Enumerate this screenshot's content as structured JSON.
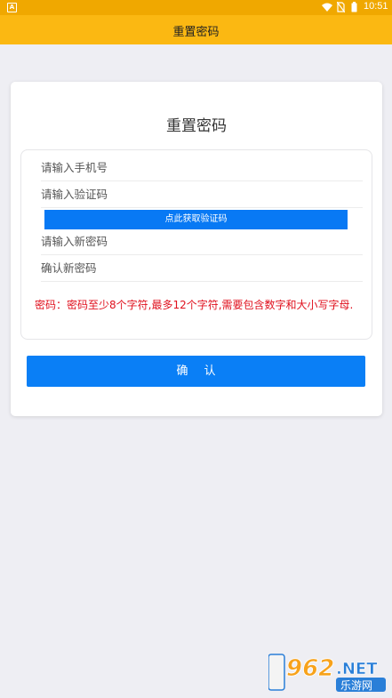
{
  "status_bar": {
    "app_icon_letter": "A",
    "time": "10:51"
  },
  "app_bar": {
    "title": "重置密码"
  },
  "card": {
    "title": "重置密码",
    "phone_placeholder": "请输入手机号",
    "code_placeholder": "请输入验证码",
    "get_code_label": "点此获取验证码",
    "new_password_placeholder": "请输入新密码",
    "confirm_password_placeholder": "确认新密码",
    "password_hint": "密码：密码至少8个字符,最多12个字符,需要包含数字和大小写字母.",
    "confirm_label": "确认"
  },
  "watermark": {
    "brand_top": "962",
    "brand_net": ".NET",
    "brand_bottom": "乐游网"
  },
  "colors": {
    "status_bar": "#f0a800",
    "app_bar": "#fbb812",
    "primary_button": "#0a7ff6",
    "hint_text": "#e0111e"
  }
}
